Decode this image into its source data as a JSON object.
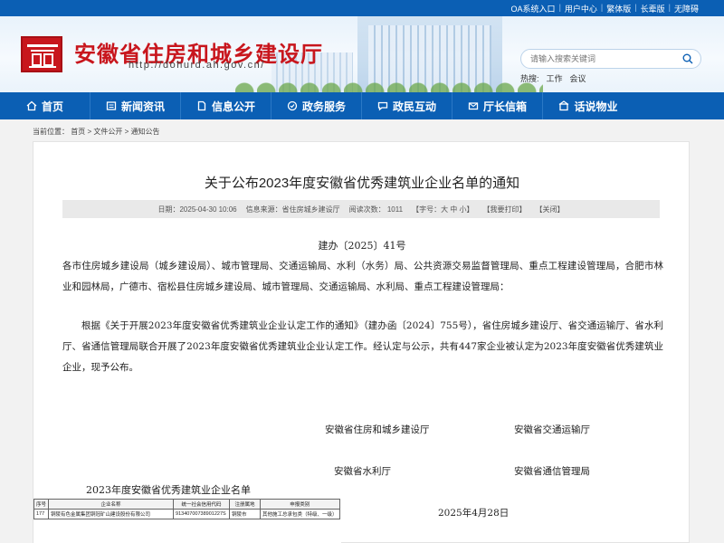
{
  "topbar": {
    "links": [
      "OA系统入口",
      "用户中心",
      "繁体版",
      "长辈版",
      "无障碍"
    ]
  },
  "header": {
    "site_title": "安徽省住房和城乡建设厅",
    "site_url": "http://dohurd.ah.gov.cn/",
    "search_placeholder": "请输入搜索关键词",
    "hot_label": "热搜:",
    "hot_words": [
      "工作",
      "会议"
    ]
  },
  "nav": {
    "items": [
      {
        "label": "首页",
        "icon": "home-icon"
      },
      {
        "label": "新闻资讯",
        "icon": "news-icon"
      },
      {
        "label": "信息公开",
        "icon": "document-icon"
      },
      {
        "label": "政务服务",
        "icon": "service-icon"
      },
      {
        "label": "政民互动",
        "icon": "interaction-icon"
      },
      {
        "label": "厅长信箱",
        "icon": "mail-icon"
      },
      {
        "label": "话说物业",
        "icon": "property-icon"
      }
    ]
  },
  "breadcrumb": {
    "label": "当前位置：",
    "items": [
      "首页",
      "文件公开",
      "通知公告"
    ],
    "separator": ">"
  },
  "article": {
    "title": "关于公布2023年度安徽省优秀建筑业企业名单的通知",
    "meta": {
      "date": "日期：2025-04-30 10:06",
      "source": "信息来源：省住房城乡建设厅",
      "views": "阅读次数：  1011",
      "font_size": "【字号：大 中 小】",
      "print": "【我要打印】",
      "close": "【关闭】"
    },
    "doc_number": "建办〔2025〕41号",
    "para1": "各市住房城乡建设局（城乡建设局）、城市管理局、交通运输局、水利（水务）局、公共资源交易监督管理局、重点工程建设管理局，合肥市林业和园林局，广德市、宿松县住房城乡建设局、城市管理局、交通运输局、水利局、重点工程建设管理局：",
    "para2": "根据《关于开展2023年度安徽省优秀建筑业企业认定工作的通知》（建办函〔2024〕755号），省住房城乡建设厅、省交通运输厅、省水利厅、省通信管理局联合开展了2023年度安徽省优秀建筑业企业认定工作。经认定与公示，共有447家企业被认定为2023年度安徽省优秀建筑业企业，现予公布。",
    "signatures": [
      "安徽省住房和城乡建设厅",
      "安徽省交通运输厅",
      "安徽省水利厅",
      "安徽省通信管理局"
    ],
    "date_sign": "2025年4月28日"
  },
  "attachment": {
    "title": "2023年度安徽省优秀建筑业企业名单",
    "headers": [
      "序号",
      "企业名称",
      "统一社会信用代码",
      "注册属地",
      "申报类别"
    ],
    "row": [
      "177",
      "铜陵有色金属集团铜冠矿山建设股份有限公司",
      "91340700738901227S",
      "铜陵市",
      "其他施工总承包类（特级、一级）"
    ]
  }
}
